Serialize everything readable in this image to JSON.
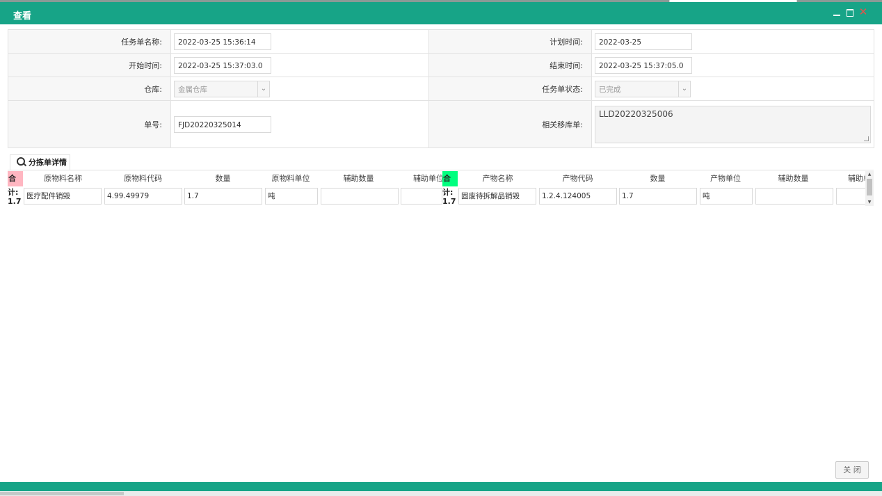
{
  "window": {
    "title": "查看"
  },
  "form": {
    "task_name_label": "任务单名称:",
    "task_name_value": "2022-03-25 15:36:14",
    "plan_time_label": "计划时间:",
    "plan_time_value": "2022-03-25",
    "start_time_label": "开始时间:",
    "start_time_value": "2022-03-25 15:37:03.0",
    "end_time_label": "结束时间:",
    "end_time_value": "2022-03-25 15:37:05.0",
    "warehouse_label": "仓库:",
    "warehouse_value": "金属仓库",
    "status_label": "任务单状态:",
    "status_value": "已完成",
    "order_no_label": "单号:",
    "order_no_value": "FJD20220325014",
    "related_label": "相关移库单:",
    "related_value": "LLD20220325006"
  },
  "tab": {
    "label": "分拣单详情"
  },
  "left_grid": {
    "sum_badge": "合",
    "sum_text": "计:\n1.7",
    "headers": [
      "原物料名称",
      "原物料代码",
      "数量",
      "原物料单位",
      "辅助数量",
      "辅助单位"
    ],
    "row": [
      "医疗配件销毁",
      "4.99.49979",
      "1.7",
      "吨",
      "",
      ""
    ],
    "badge_color": "#ffb6c1"
  },
  "right_grid": {
    "sum_badge": "合",
    "sum_text": "计:\n1.7",
    "headers": [
      "产物名称",
      "产物代码",
      "数量",
      "产物单位",
      "辅助数量",
      "辅助单位"
    ],
    "row": [
      "固废待拆解品销毁",
      "1.2.4.124005",
      "1.7",
      "吨",
      "",
      ""
    ],
    "badge_color": "#00ff7f"
  },
  "footer": {
    "close_label": "关 闭"
  },
  "colors": {
    "accent": "#17a487"
  }
}
